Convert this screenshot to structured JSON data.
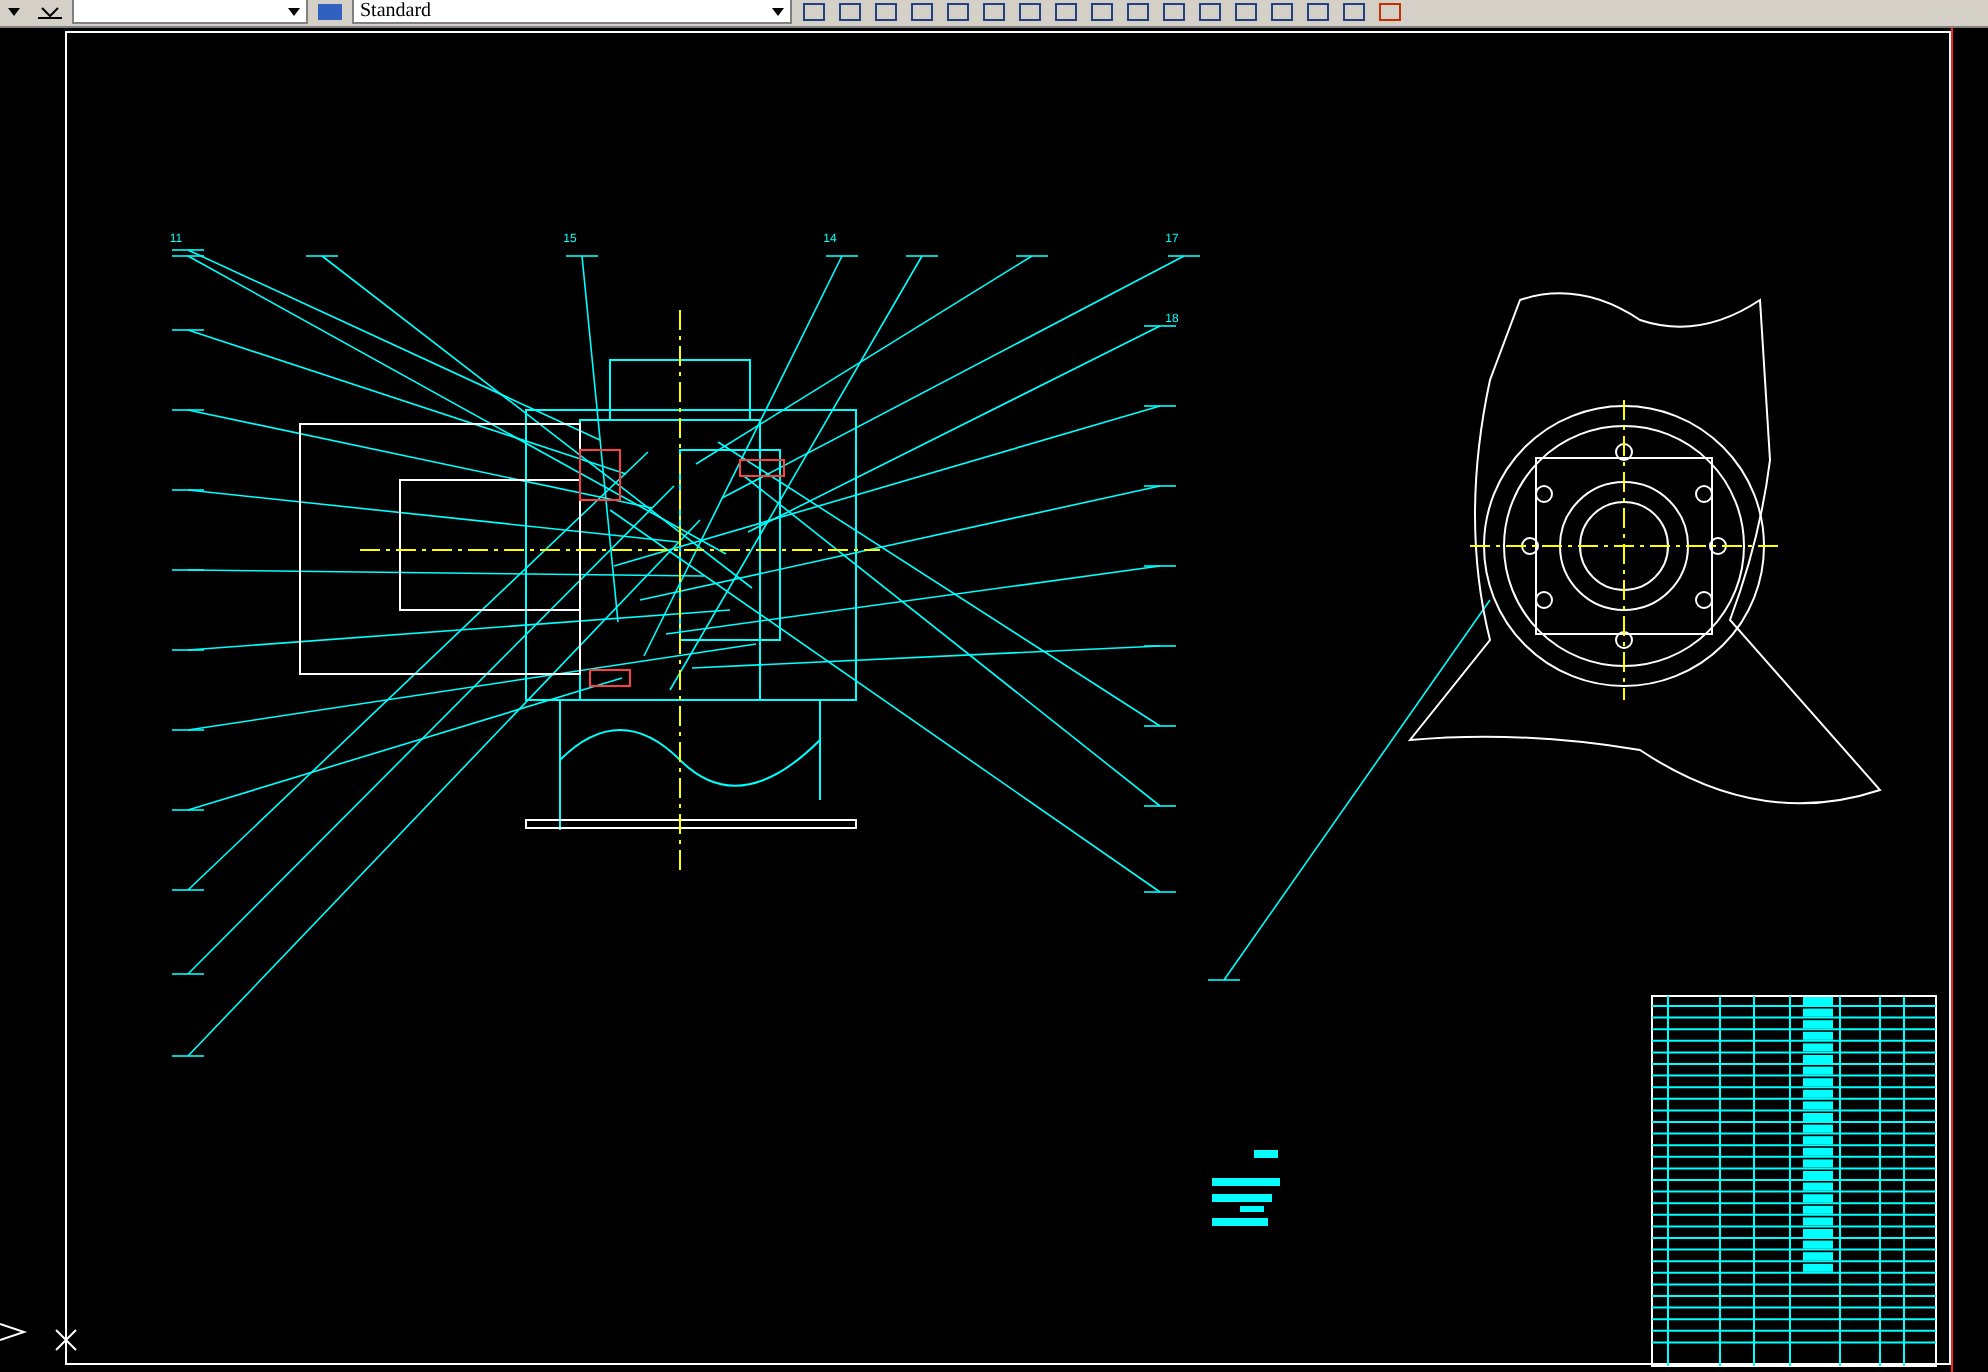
{
  "toolbar": {
    "style_dropdown": {
      "value": "Standard"
    }
  },
  "callouts": [
    {
      "text": "11"
    },
    {
      "text": "15"
    },
    {
      "text": "14"
    },
    {
      "text": "17"
    },
    {
      "text": "18"
    }
  ]
}
